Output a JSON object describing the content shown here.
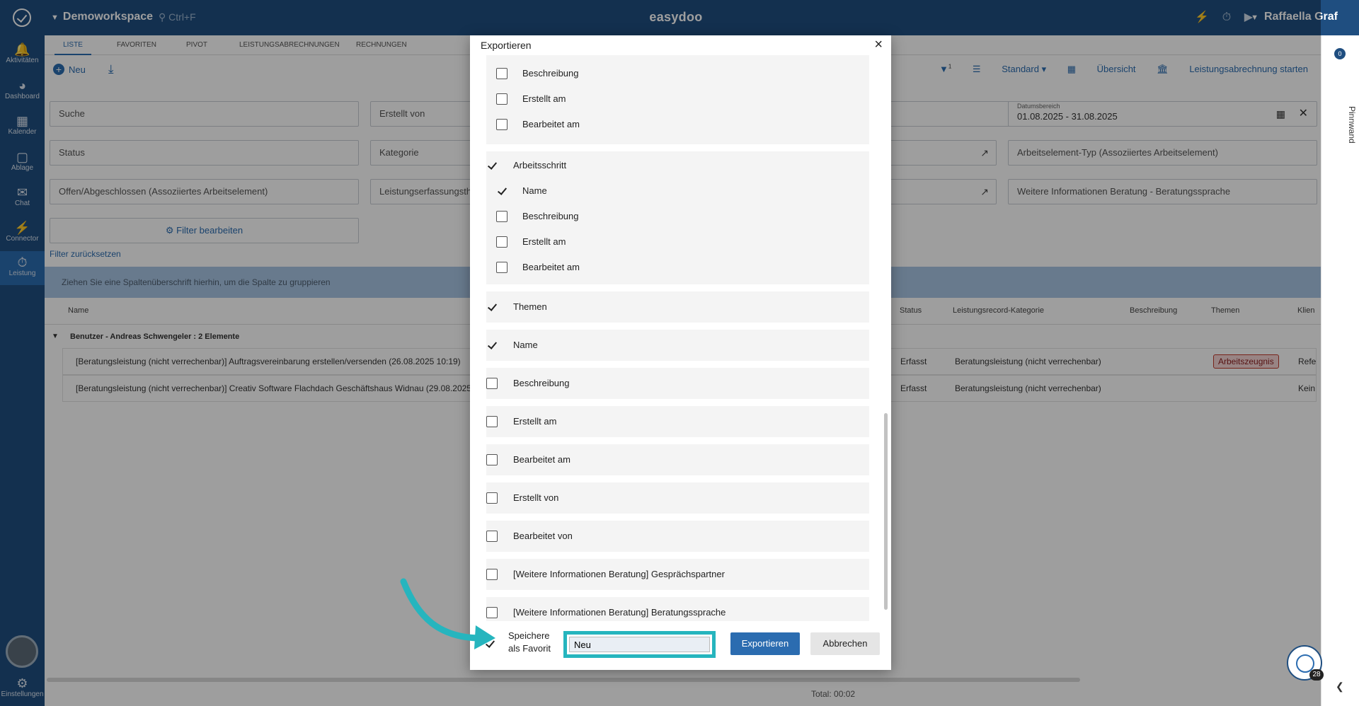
{
  "app": {
    "workspace": "Demoworkspace",
    "search_hint": "Ctrl+F",
    "brand": "easydoo",
    "user": "Raffaella Graf"
  },
  "leftnav": [
    {
      "label": "Aktivitäten",
      "icon": "bell-icon"
    },
    {
      "label": "Dashboard",
      "icon": "gauge-icon"
    },
    {
      "label": "Kalender",
      "icon": "calendar-icon"
    },
    {
      "label": "Ablage",
      "icon": "folder-icon"
    },
    {
      "label": "Chat",
      "icon": "chat-icon"
    },
    {
      "label": "Connector",
      "icon": "plug-icon"
    },
    {
      "label": "Leistung",
      "icon": "stopwatch-icon"
    }
  ],
  "settings_label": "Einstellungen",
  "rightrail": {
    "badge": "0",
    "label": "Pinnwand"
  },
  "tabs": [
    "Liste",
    "Favoriten",
    "Pivot",
    "Leistungsabrechnungen",
    "Rechnungen"
  ],
  "toolbar": {
    "new_label": "Neu",
    "filter_badge": "1",
    "standard_label": "Standard",
    "overview_label": "Übersicht",
    "billing_label": "Leistungsabrechnung starten"
  },
  "filters": {
    "search": "Suche",
    "created_by": "Erstellt von",
    "date_label": "Datumsbereich",
    "date_value": "01.08.2025 - 31.08.2025",
    "status": "Status",
    "category": "Kategorie",
    "element_type": "Arbeitselement-Typ (Assoziiertes Arbeitselement)",
    "open_closed": "Offen/Abgeschlossen (Assoziiertes Arbeitselement)",
    "service_type": "Leistungserfassungsth",
    "more_info": "Weitere Informationen Beratung - Beratungssprache",
    "edit_filter": "Filter bearbeiten",
    "reset": "Filter zurücksetzen"
  },
  "group_hint": "Ziehen Sie eine Spaltenüberschrift hierhin, um die Spalte zu gruppieren",
  "grid": {
    "columns": [
      "Name",
      "Status",
      "Leistungsrecord-Kategorie",
      "Beschreibung",
      "Themen",
      "Klien"
    ],
    "group_row": "Benutzer - Andreas Schwengeler : 2 Elemente",
    "rows": [
      {
        "name": "[Beratungsleistung (nicht verrechenbar)] Auftragsvereinbarung erstellen/versenden (26.08.2025 10:19)",
        "status": "Erfasst",
        "category": "Beratungsleistung (nicht verrechenbar)",
        "theme": "Arbeitszeugnis",
        "client": "Refe"
      },
      {
        "name": "[Beratungsleistung (nicht verrechenbar)] Creativ Software Flachdach Geschäftshaus Widnau (29.08.2025",
        "status": "Erfasst",
        "category": "Beratungsleistung (nicht verrechenbar)",
        "theme": "",
        "client": "Kein"
      }
    ],
    "total": "Total: 00:02"
  },
  "modal": {
    "title": "Exportieren",
    "close": "×",
    "section1": [
      {
        "label": "Beschreibung",
        "checked": false
      },
      {
        "label": "Erstellt am",
        "checked": false
      },
      {
        "label": "Bearbeitet am",
        "checked": false
      }
    ],
    "section2_header": {
      "label": "Arbeitsschritt",
      "checked": true
    },
    "section2": [
      {
        "label": "Name",
        "checked": true
      },
      {
        "label": "Beschreibung",
        "checked": false
      },
      {
        "label": "Erstellt am",
        "checked": false
      },
      {
        "label": "Bearbeitet am",
        "checked": false
      }
    ],
    "fields": [
      {
        "label": "Themen",
        "checked": true
      },
      {
        "label": "Name",
        "checked": true
      },
      {
        "label": "Beschreibung",
        "checked": false
      },
      {
        "label": "Erstellt am",
        "checked": false
      },
      {
        "label": "Bearbeitet am",
        "checked": false
      },
      {
        "label": "Erstellt von",
        "checked": false
      },
      {
        "label": "Bearbeitet von",
        "checked": false
      },
      {
        "label": "[Weitere Informationen Beratung] Gesprächspartner",
        "checked": false
      },
      {
        "label": "[Weitere Informationen Beratung] Beratungssprache",
        "checked": false
      }
    ],
    "save_fav_label": "Speichere als Favorit",
    "fav_name_value": "Neu",
    "export_button": "Exportieren",
    "cancel_button": "Abbrechen"
  },
  "fab_badge": "28",
  "colors": {
    "primary": "#1f4e80",
    "accent": "#2b6cb0",
    "highlight": "#26b5be"
  }
}
